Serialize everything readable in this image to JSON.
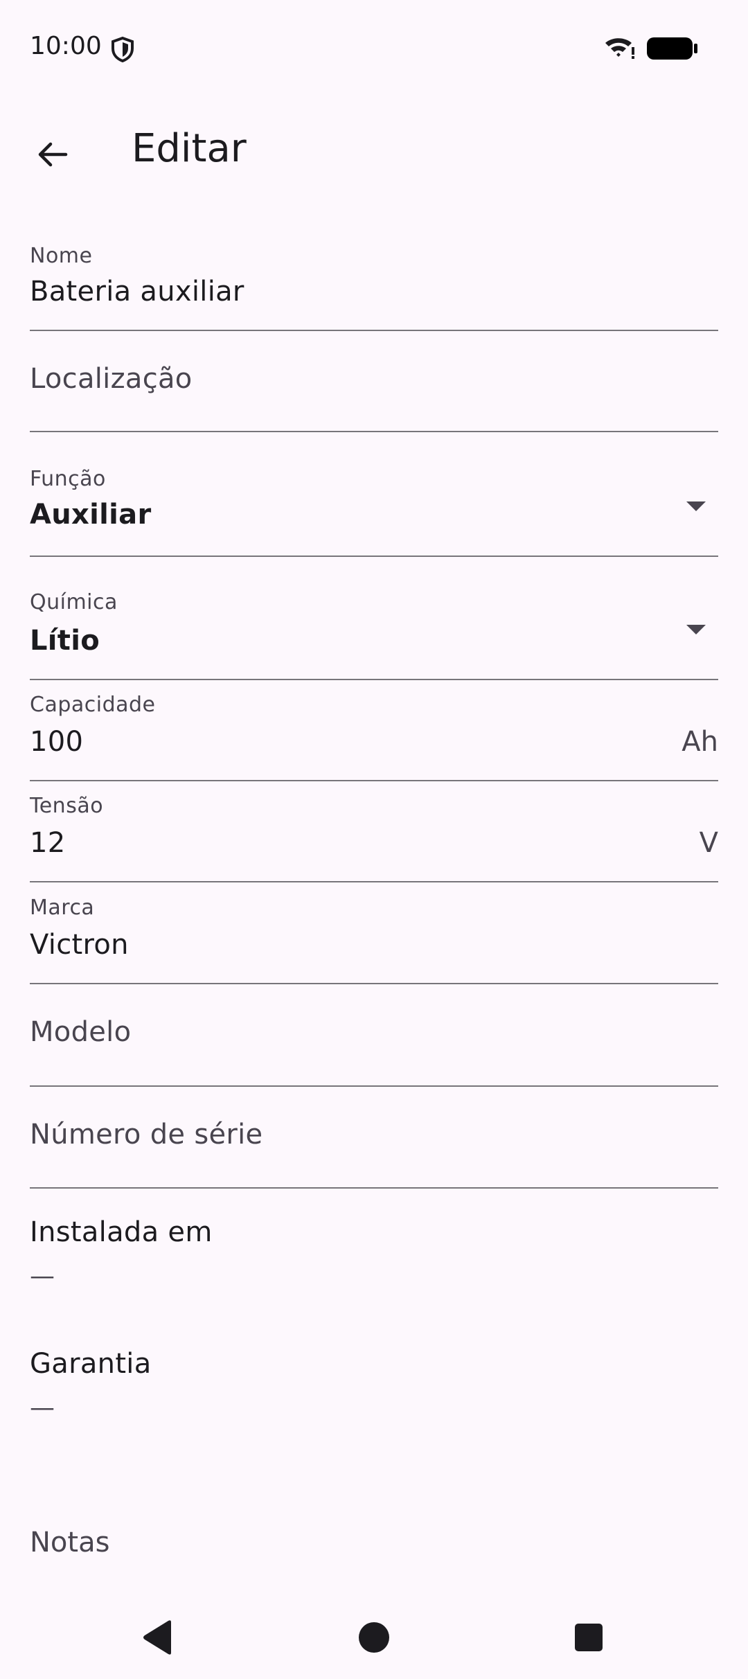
{
  "status_bar": {
    "time": "10:00"
  },
  "app_bar": {
    "title": "Editar"
  },
  "form": {
    "nome": {
      "label": "Nome",
      "value": "Bateria auxiliar"
    },
    "localizacao": {
      "placeholder": "Localização"
    },
    "funcao": {
      "label": "Função",
      "value": "Auxiliar"
    },
    "quimica": {
      "label": "Química",
      "value": "Lítio"
    },
    "capacidade": {
      "label": "Capacidade",
      "value": "100",
      "suffix": "Ah"
    },
    "tensao": {
      "label": "Tensão",
      "value": "12",
      "suffix": "V"
    },
    "marca": {
      "label": "Marca",
      "value": "Victron"
    },
    "modelo": {
      "placeholder": "Modelo"
    },
    "numero_serie": {
      "placeholder": "Número de série"
    },
    "instalada_em": {
      "label": "Instalada em",
      "value": "—"
    },
    "garantia": {
      "label": "Garantia",
      "value": "—"
    },
    "notas": {
      "placeholder": "Notas"
    }
  }
}
